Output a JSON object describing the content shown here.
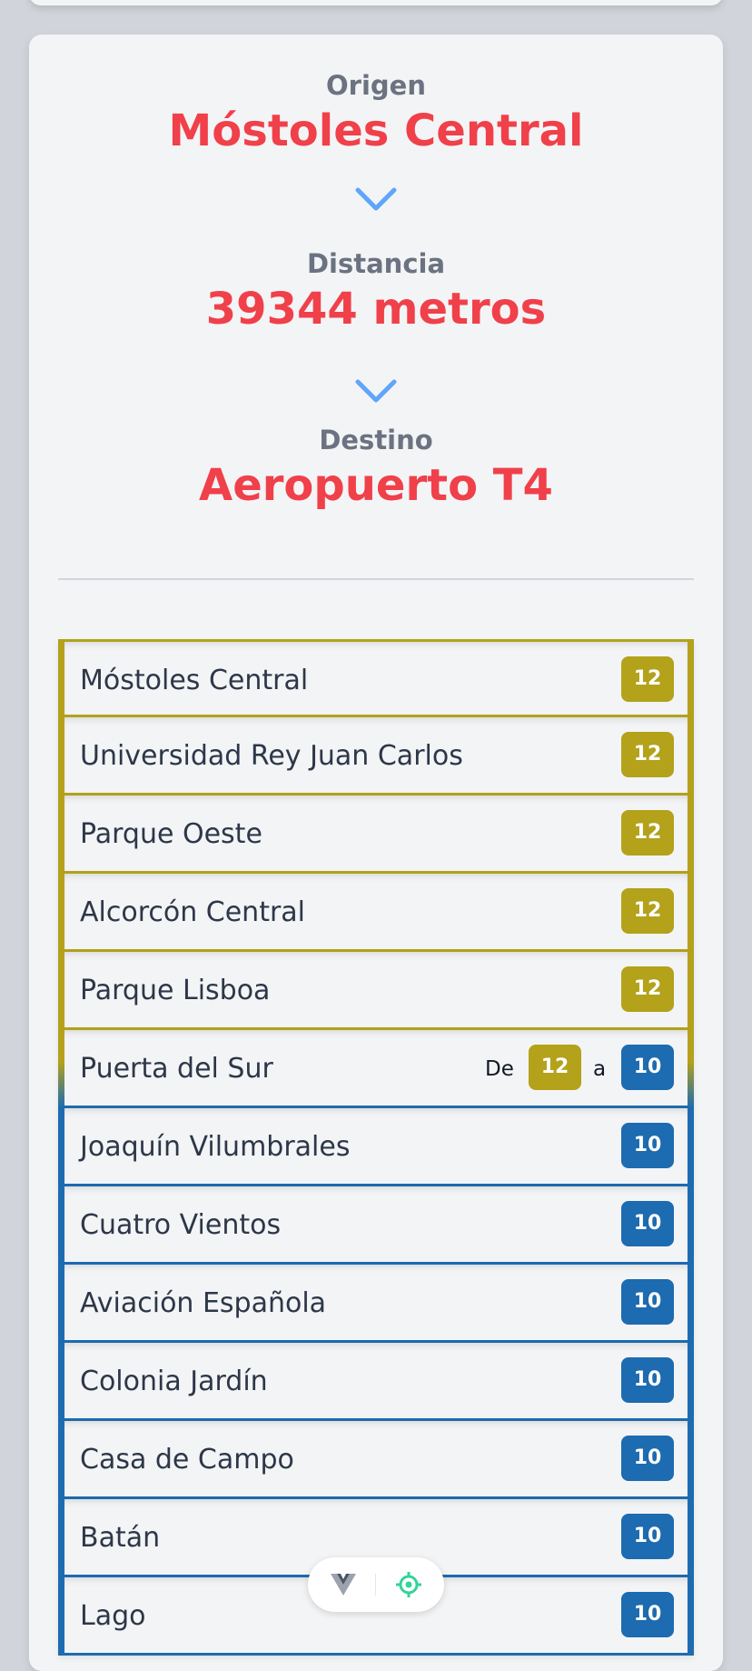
{
  "route": {
    "origin_label": "Origen",
    "origin": "Móstoles Central",
    "distance_label": "Distancia",
    "distance": "39344 metros",
    "destination_label": "Destino",
    "destination": "Aeropuerto T4"
  },
  "colors": {
    "line12": "#b3a21a",
    "line10": "#1d6bb0",
    "accent": "#f0404a",
    "chevron": "#60a5fa"
  },
  "stations": [
    {
      "name": "Móstoles Central",
      "line": "12"
    },
    {
      "name": "Universidad Rey Juan Carlos",
      "line": "12"
    },
    {
      "name": "Parque Oeste",
      "line": "12"
    },
    {
      "name": "Alcorcón Central",
      "line": "12"
    },
    {
      "name": "Parque Lisboa",
      "line": "12"
    },
    {
      "name": "Puerta del Sur",
      "from_label": "De",
      "from_line": "12",
      "to_label": "a",
      "to_line": "10"
    },
    {
      "name": "Joaquín Vilumbrales",
      "line": "10"
    },
    {
      "name": "Cuatro Vientos",
      "line": "10"
    },
    {
      "name": "Aviación Española",
      "line": "10"
    },
    {
      "name": "Colonia Jardín",
      "line": "10"
    },
    {
      "name": "Casa de Campo",
      "line": "10"
    },
    {
      "name": "Batán",
      "line": "10"
    },
    {
      "name": "Lago",
      "line": "10"
    }
  ],
  "toolbar": {
    "icons": [
      "vue-logo-icon",
      "locate-icon"
    ]
  }
}
